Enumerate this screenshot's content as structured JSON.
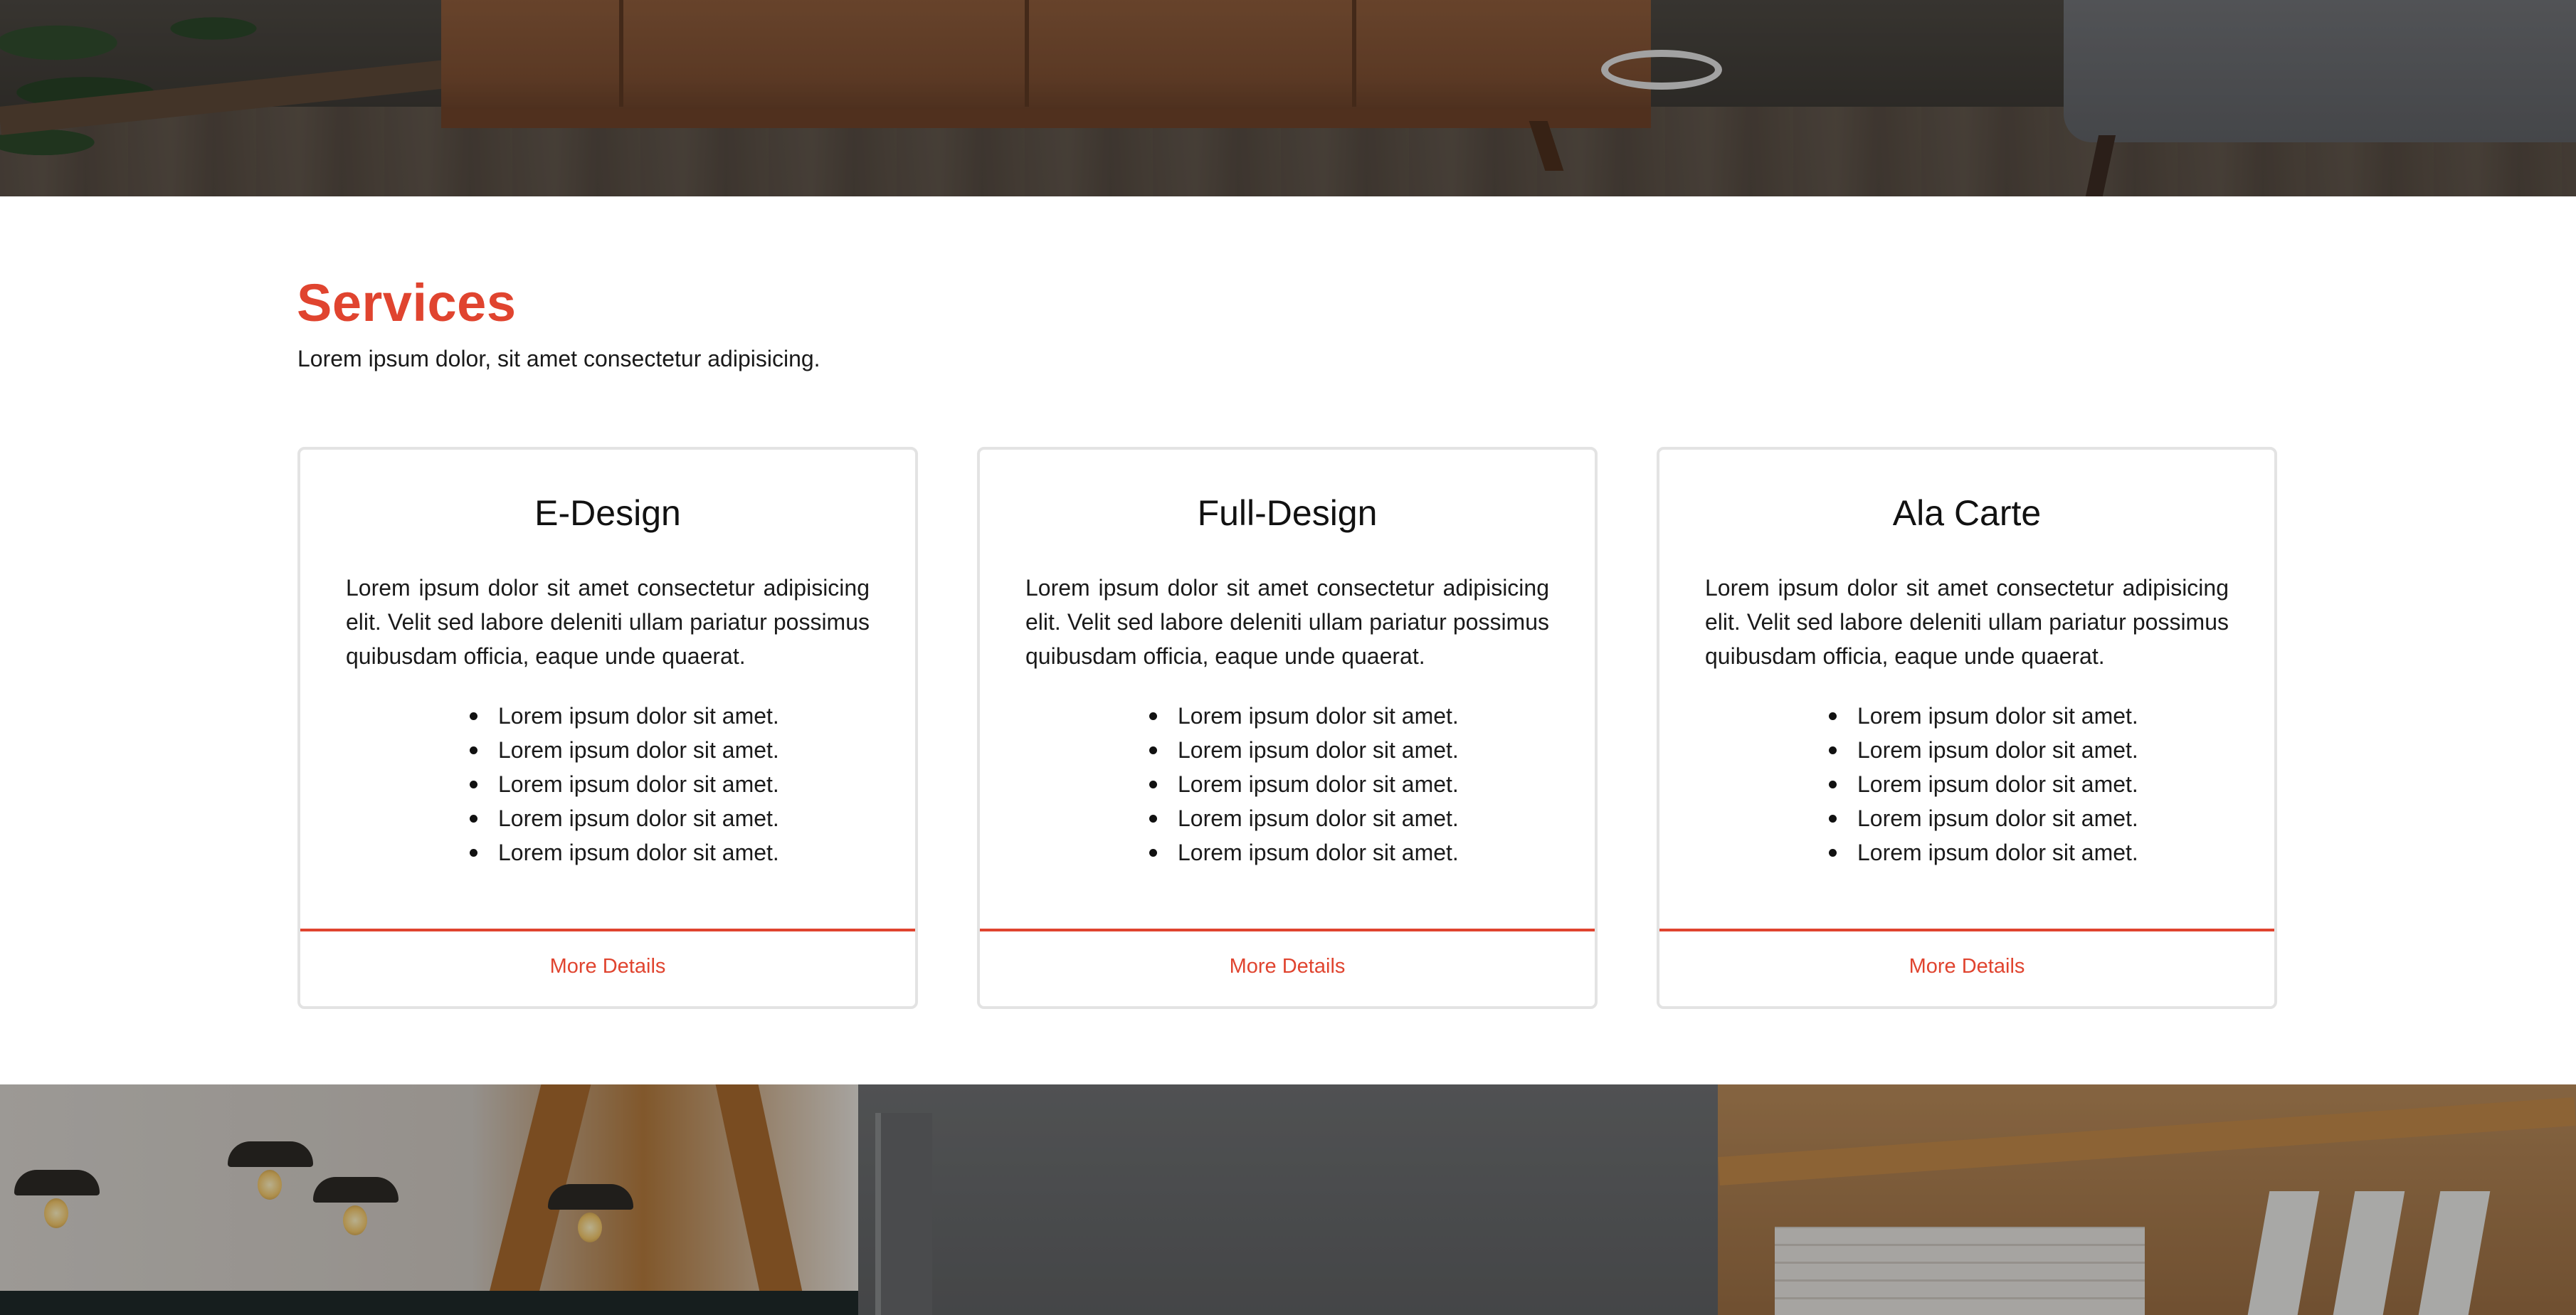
{
  "hero": {
    "image": "living-room-photo"
  },
  "services": {
    "title": "Services",
    "subtitle": "Lorem ipsum dolor, sit amet consectetur adipisicing.",
    "accent_color": "#e0442f",
    "cards": [
      {
        "title": "E-Design",
        "text": "Lorem ipsum dolor sit amet consectetur adipisicing elit. Velit sed labore deleniti ullam pariatur possimus quibusdam officia, eaque unde quaerat.",
        "items": [
          "Lorem ipsum dolor sit amet.",
          "Lorem ipsum dolor sit amet.",
          "Lorem ipsum dolor sit amet.",
          "Lorem ipsum dolor sit amet.",
          "Lorem ipsum dolor sit amet."
        ],
        "link_label": "More Details"
      },
      {
        "title": "Full-Design",
        "text": "Lorem ipsum dolor sit amet consectetur adipisicing elit. Velit sed labore deleniti ullam pariatur possimus quibusdam officia, eaque unde quaerat.",
        "items": [
          "Lorem ipsum dolor sit amet.",
          "Lorem ipsum dolor sit amet.",
          "Lorem ipsum dolor sit amet.",
          "Lorem ipsum dolor sit amet.",
          "Lorem ipsum dolor sit amet."
        ],
        "link_label": "More Details"
      },
      {
        "title": "Ala Carte",
        "text": "Lorem ipsum dolor sit amet consectetur adipisicing elit. Velit sed labore deleniti ullam pariatur possimus quibusdam officia, eaque unde quaerat.",
        "items": [
          "Lorem ipsum dolor sit amet.",
          "Lorem ipsum dolor sit amet.",
          "Lorem ipsum dolor sit amet.",
          "Lorem ipsum dolor sit amet.",
          "Lorem ipsum dolor sit amet."
        ],
        "link_label": "More Details"
      }
    ]
  },
  "gallery": {
    "images": [
      "kitchen-pendant-lights-photo",
      "white-room-photo",
      "wood-beam-attic-photo"
    ]
  }
}
